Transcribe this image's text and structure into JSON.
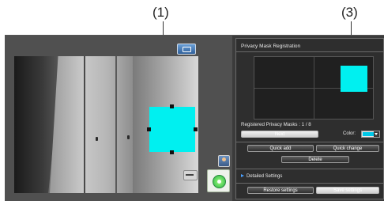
{
  "callouts": {
    "left": "(1)",
    "right": "(3)"
  },
  "privacy_panel": {
    "title": "Privacy Mask Registration",
    "registered_label": "Registered Privacy Masks : 1 / 8",
    "next_button": "Next",
    "color_label": "Color:",
    "color_value": "#00c8e8",
    "quick_add_button": "Quick add",
    "quick_change_button": "Quick change",
    "delete_button": "Delete",
    "detailed_settings": "Detailed Settings",
    "restore_button": "Restore settings",
    "save_button": "Save settings"
  },
  "colors": {
    "mask": "#00f0f0",
    "panel_bg": "#2e2e2e",
    "window_bg": "#3b3b3b"
  },
  "icons": [
    "display-mode-icon",
    "person-icon",
    "card-icon",
    "pan-tilt-icon",
    "dropdown-arrow-icon",
    "expand-triangle-icon"
  ]
}
